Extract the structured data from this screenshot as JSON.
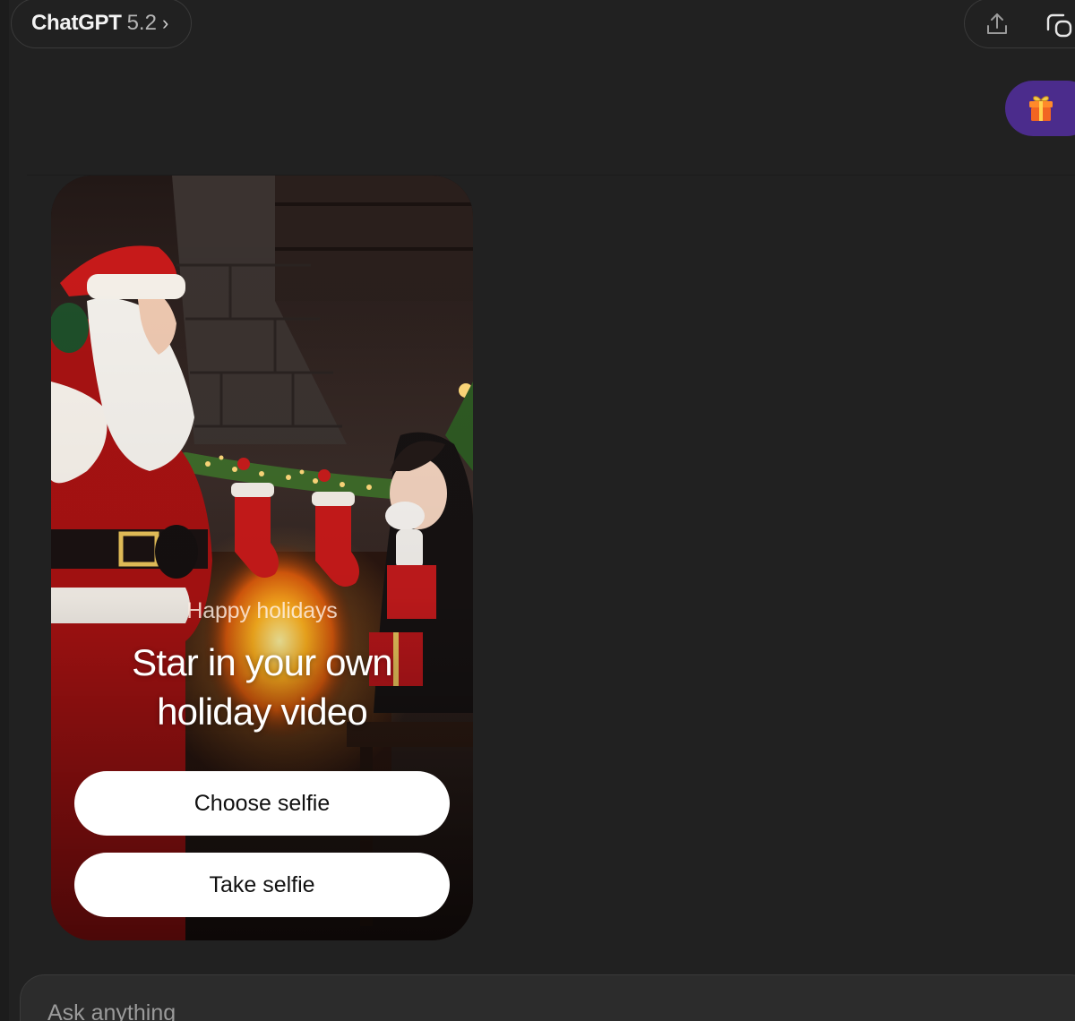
{
  "header": {
    "model_name": "ChatGPT",
    "model_version": "5.2",
    "chevron": "›"
  },
  "icons": {
    "share": "share-icon",
    "sidebar": "open-sidebar-icon",
    "gift": "gift-icon"
  },
  "colors": {
    "background": "#212121",
    "gift_bubble": "#4b2c8c",
    "button_bg": "#ffffff",
    "button_text": "#111111"
  },
  "card": {
    "eyebrow": "Happy holidays",
    "title": "Star in your own holiday video",
    "choose_button": "Choose selfie",
    "take_button": "Take selfie"
  },
  "composer": {
    "placeholder": "Ask anything"
  }
}
